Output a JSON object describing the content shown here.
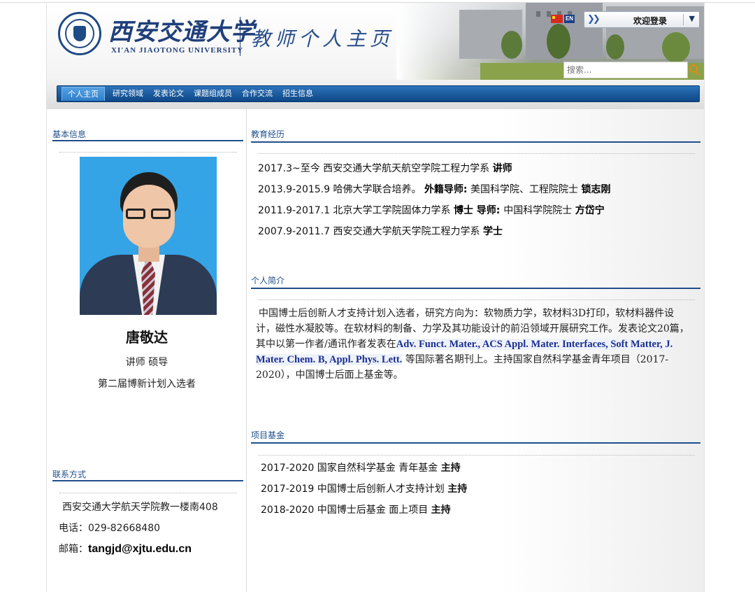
{
  "header": {
    "school_cn": "西安交通大学",
    "school_en": "XI'AN JIAOTONG UNIVERSITY",
    "site_title": "教师个人主页",
    "lang_en": "EN",
    "login_label": "欢迎登录",
    "search_placeholder": "搜索..."
  },
  "nav": [
    {
      "label": "个人主页",
      "active": true
    },
    {
      "label": "研究领域"
    },
    {
      "label": "发表论文"
    },
    {
      "label": "课题组成员"
    },
    {
      "label": "合作交流"
    },
    {
      "label": "招生信息"
    }
  ],
  "left": {
    "basic_title": "基本信息",
    "name": "唐敬达",
    "title1": "讲师 硕导",
    "title2": "第二届博新计划入选者",
    "contact_title": "联系方式",
    "address": "西安交通大学航天学院教一楼南408",
    "phone_label": "电话：",
    "phone": "029-82668480",
    "email_label": "邮箱：",
    "email": "tangjd@xjtu.edu.cn"
  },
  "education": {
    "title": "教育经历",
    "items": [
      {
        "a": "2017.3~至今  西安交通大学航天航空学院工程力学系 ",
        "b": "讲师",
        "c": "",
        "d": "",
        "e": ""
      },
      {
        "a": "2013.9-2015.9 哈佛大学联合培养。 ",
        "b": "外籍导师:",
        "c": " 美国科学院、工程院院士 ",
        "d": "锁志刚",
        "e": ""
      },
      {
        "a": "2011.9-2017.1 北京大学工学院固体力学系 ",
        "b": "博士",
        "c": "  导师: ",
        "d": "中国科学院院士 ",
        "e": "方岱宁"
      },
      {
        "a": "2007.9-2011.7 西安交通大学航天学院工程力学系 ",
        "b": "学士",
        "c": "",
        "d": "",
        "e": ""
      }
    ]
  },
  "bio": {
    "title": "个人简介",
    "p1": "中国博士后创新人才支持计划入选者，研究方向为：软物质力学，软材料3D打印，软材料器件设计，磁性水凝胶等。在软材料的制备、力学及其功能设计的前沿领域开展研究工作。发表论文20篇，其中以第一作者/通讯作者发表在",
    "journals": "Adv. Funct. Mater., ACS Appl. Mater. Interfaces, Soft Matter, J. Mater. Chem. B, Appl. Phys. Lett.",
    "p2": " 等国际著名期刊上。主持国家自然科学基金青年项目（2017-2020），中国博士后面上基金等。"
  },
  "projects": {
    "title": "项目基金",
    "items": [
      {
        "text": "2017-2020 国家自然科学基金 青年基金 ",
        "role": "主持"
      },
      {
        "text": "2017-2019 中国博士后创新人才支持计划 ",
        "role": "主持"
      },
      {
        "text": "2018-2020 中国博士后基金 面上项目 ",
        "role": "主持"
      }
    ]
  },
  "colors": {
    "accent": "#1f4f8a",
    "nav": "#1b5a9c",
    "journal": "#1a2e8f"
  }
}
